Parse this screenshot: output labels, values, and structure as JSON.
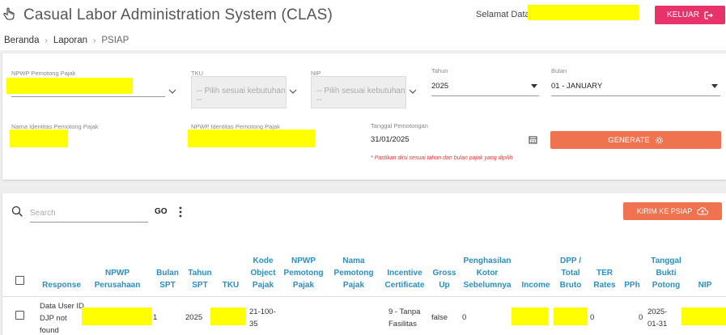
{
  "header": {
    "title": "Casual Labor Administration System (CLAS)",
    "welcome": "Selamat Datang,",
    "logout_label": "KELUAR"
  },
  "breadcrumb": {
    "items": [
      "Beranda",
      "Laporan",
      "PSIAP"
    ]
  },
  "form": {
    "npwp_pemotong_label": "NPWP Pemotong Pajak",
    "tku_label": "TKU",
    "tku_placeholder": "-- Pilih sesuai kebutuhan --",
    "nip_label": "NIP",
    "nip_placeholder": "-- Pilih sesuai kebutuhan --",
    "tahun_label": "Tahun",
    "tahun_value": "2025",
    "bulan_label": "Bulan",
    "bulan_value": "01 - JANUARY",
    "nama_identitas_label": "Nama Identitas Pemotong Pajak",
    "npwp_identitas_label": "NPWP Identitas Pemotong Pajak",
    "tanggal_label": "Tanggal Pemotongan",
    "tanggal_value": "31/01/2025",
    "generate_label": "GENERATE",
    "hint": "* Pastikan diisi sesuai tahun dan bulan pajak yang dipilih"
  },
  "toolbar": {
    "search_placeholder": "Search",
    "go_label": "GO",
    "kirim_label": "KIRIM KE PSIAP"
  },
  "table": {
    "headers": {
      "response": "Response",
      "npwp_perusahaan": "NPWP Perusahaan",
      "bulan_spt": "Bulan SPT",
      "tahun_spt": "Tahun SPT",
      "tku": "TKU",
      "kode_object": "Kode Object Pajak",
      "npwp_pemotong": "NPWP Pemotong Pajak",
      "nama_pemotong": "Nama Pemotong Pajak",
      "incentive": "Incentive Certificate",
      "gross_up": "Gross Up",
      "penghasilan": "Penghasilan Kotor Sebelumnya",
      "income": "Income",
      "dpp": "DPP / Total Bruto",
      "ter": "TER Rates",
      "pph": "PPh",
      "tanggal_bukti": "Tanggal Bukti Potong",
      "nip": "NIP"
    },
    "row": {
      "response": "Data User ID DJP not found",
      "bulan_spt": "1",
      "tahun_spt": "2025",
      "kode_object": "21-100-35",
      "incentive": "9 - Tanpa Fasilitas",
      "gross_up": "false",
      "penghasilan": "0",
      "ter": "0",
      "pph": "0",
      "tanggal_bukti": "2025-01-31"
    }
  },
  "colors": {
    "logout": "#e8336a",
    "action": "#f0734f",
    "header_text": "#2a8fc4",
    "redaction": "#ffff00"
  }
}
